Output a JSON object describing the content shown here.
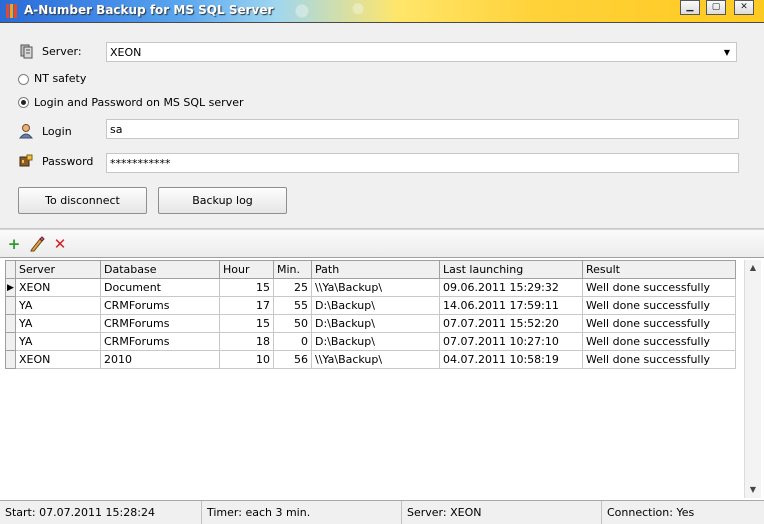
{
  "window": {
    "title": "A-Number Backup for MS SQL Server",
    "controls": [
      "minimize",
      "maximize",
      "close"
    ]
  },
  "connection": {
    "server_label": "Server:",
    "server_value": "XEON",
    "nt_safety_label": "NT safety",
    "login_mode_label": "Login and Password on MS SQL server",
    "selected_auth": "login_password",
    "login_label": "Login",
    "login_value": "sa",
    "password_label": "Password",
    "password_value": "***********",
    "disconnect_label": "To disconnect",
    "backup_log_label": "Backup log"
  },
  "toolbar": {
    "add_icon": "add-icon",
    "edit_icon": "edit-icon",
    "delete_icon": "delete-icon"
  },
  "grid": {
    "columns": [
      "Server",
      "Database",
      "Hour",
      "Min.",
      "Path",
      "Last launching",
      "Result"
    ],
    "rows": [
      {
        "server": "XEON",
        "database": "Document",
        "hour": "15",
        "min": "25",
        "path": "\\\\Ya\\Backup\\",
        "last": "09.06.2011 15:29:32",
        "result": "Well done successfully",
        "current": true
      },
      {
        "server": "YA",
        "database": "CRMForums",
        "hour": "17",
        "min": "55",
        "path": "D:\\Backup\\",
        "last": "14.06.2011 17:59:11",
        "result": "Well done successfully",
        "current": false
      },
      {
        "server": "YA",
        "database": "CRMForums",
        "hour": "15",
        "min": "50",
        "path": "D:\\Backup\\",
        "last": "07.07.2011 15:52:20",
        "result": "Well done successfully",
        "current": false
      },
      {
        "server": "YA",
        "database": "CRMForums",
        "hour": "18",
        "min": "0",
        "path": "D:\\Backup\\",
        "last": "07.07.2011 10:27:10",
        "result": "Well done successfully",
        "current": false
      },
      {
        "server": "XEON",
        "database": "2010",
        "hour": "10",
        "min": "56",
        "path": "\\\\Ya\\Backup\\",
        "last": "04.07.2011 10:58:19",
        "result": "Well done successfully",
        "current": false
      }
    ]
  },
  "status": {
    "start": "Start: 07.07.2011 15:28:24",
    "timer": "Timer: each 3 min.",
    "server": "Server: XEON",
    "connection": "Connection: Yes"
  },
  "colors": {
    "title_gradient_start": "#2a6bd6",
    "title_gradient_end": "#ffca20",
    "add_icon": "#2e9a2e",
    "delete_icon": "#d42020",
    "edit_icon": "#c07a20"
  }
}
